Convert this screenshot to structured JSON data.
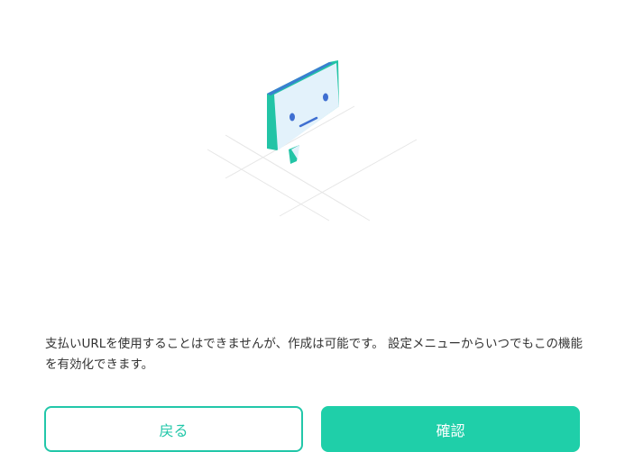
{
  "dialog": {
    "message": "支払いURLを使用することはできませんが、作成は可能です。 設定メニューからいつでもこの機能を有効化できます。",
    "back_label": "戻る",
    "confirm_label": "確認"
  },
  "colors": {
    "accent": "#1fcfa9",
    "bubble_face": "#e3f2fb",
    "bubble_side": "#22c4a6",
    "bubble_top": "#3a7fd0",
    "eyes": "#3f6fd1"
  },
  "icons": {
    "illustration": "sad-chat-bubble-icon"
  }
}
